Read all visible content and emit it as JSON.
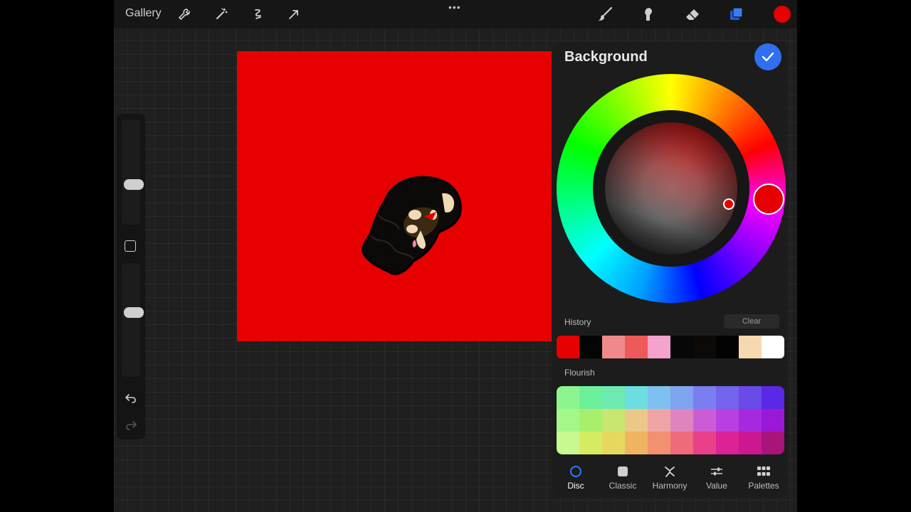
{
  "topbar": {
    "gallery_label": "Gallery",
    "more_dots": "•••",
    "tools": [
      "wrench-icon",
      "magic-wand-icon",
      "selection-icon",
      "transform-arrow-icon"
    ],
    "right_tools": [
      "brush-icon",
      "smudge-icon",
      "eraser-icon",
      "layers-icon"
    ],
    "current_color": "#e60000"
  },
  "sidebar": {
    "brush_size_level": 0.37,
    "opacity_level": 0.57
  },
  "canvas": {
    "background_color": "#e60000"
  },
  "color_panel": {
    "title": "Background",
    "history_label": "History",
    "clear_label": "Clear",
    "history_swatches": [
      "#e60000",
      "#050505",
      "#f08a8a",
      "#ee5a5a",
      "#f3a3cc",
      "#070707",
      "#0d0906",
      "#030303",
      "#f7d9b1",
      "#ffffff"
    ],
    "flourish_label": "Flourish",
    "flourish_swatches": [
      "#8df58d",
      "#6cf09a",
      "#6ceab0",
      "#6cdde0",
      "#7ec0f0",
      "#7fa4f0",
      "#7a7ef0",
      "#7264ec",
      "#6a4ae8",
      "#5a28e6",
      "#a5f78a",
      "#a8f06c",
      "#c8e672",
      "#ecc888",
      "#efa5a5",
      "#e084c0",
      "#cc5cd6",
      "#b840e0",
      "#a828e0",
      "#9a18d8",
      "#c8f890",
      "#d6ec60",
      "#e6d85e",
      "#f0b460",
      "#f29070",
      "#ef6a7c",
      "#e8408a",
      "#dc2294",
      "#cc1890",
      "#a8147a"
    ],
    "tabs": [
      {
        "label": "Disc",
        "icon": "disc-icon",
        "active": true
      },
      {
        "label": "Classic",
        "icon": "classic-square-icon",
        "active": false
      },
      {
        "label": "Harmony",
        "icon": "harmony-icon",
        "active": false
      },
      {
        "label": "Value",
        "icon": "sliders-icon",
        "active": false
      },
      {
        "label": "Palettes",
        "icon": "grid-icon",
        "active": false
      }
    ]
  }
}
